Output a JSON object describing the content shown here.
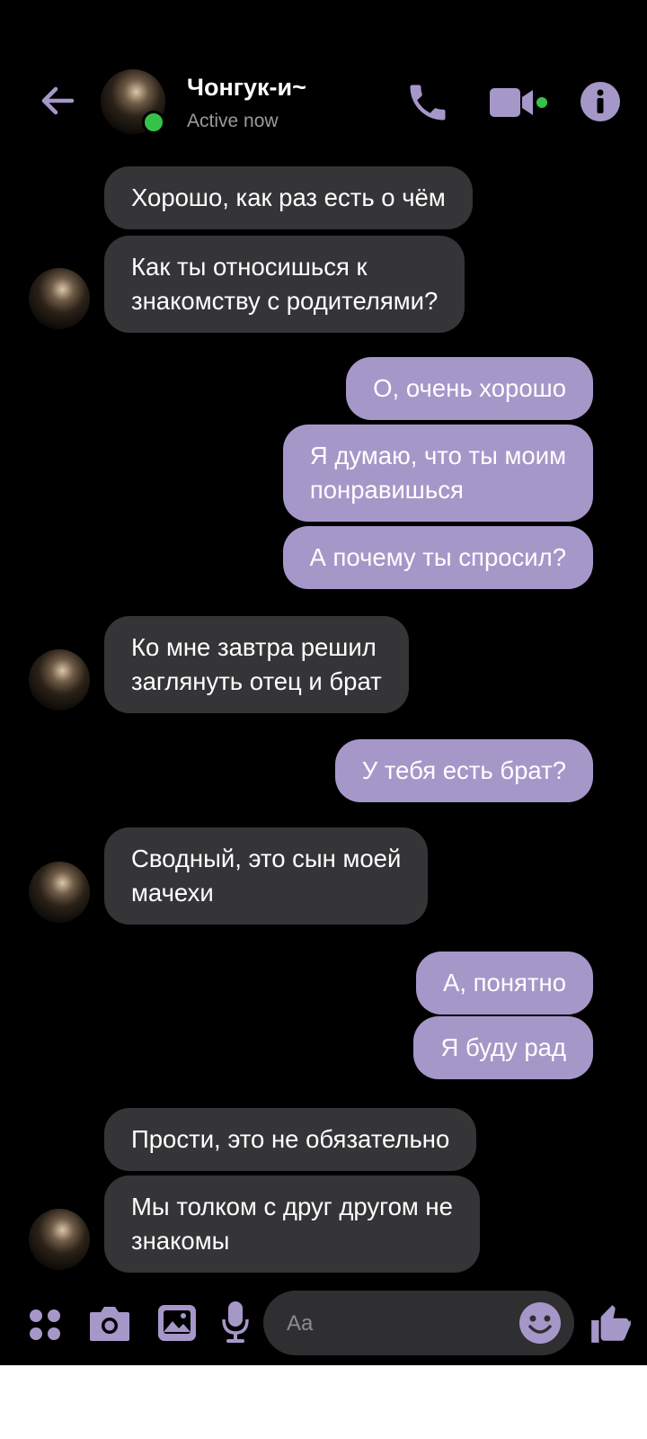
{
  "header": {
    "contact_name": "Чонгук-и~",
    "status": "Active now",
    "icons": [
      "back-arrow-icon",
      "phone-icon",
      "video-camera-icon",
      "info-icon"
    ]
  },
  "messages": [
    {
      "direction": "in",
      "text": "Хорошо, как раз есть о чём"
    },
    {
      "direction": "in",
      "text": "Как ты относишься к\nзнакомству с родителями?"
    },
    {
      "direction": "out",
      "text": "О, очень хорошо"
    },
    {
      "direction": "out",
      "text": "Я думаю, что ты моим\nпонравишься"
    },
    {
      "direction": "out",
      "text": "А почему ты спросил?"
    },
    {
      "direction": "in",
      "text": "Ко мне завтра решил\nзаглянуть отец и брат"
    },
    {
      "direction": "out",
      "text": "У тебя есть брат?"
    },
    {
      "direction": "in",
      "text": "Сводный, это сын моей\nмачехи"
    },
    {
      "direction": "out",
      "text": "А, понятно"
    },
    {
      "direction": "out",
      "text": "Я буду рад"
    },
    {
      "direction": "in",
      "text": "Прости, это не обязательно"
    },
    {
      "direction": "in",
      "text": "Мы толком с друг другом не\nзнакомы"
    }
  ],
  "composer": {
    "placeholder": "Aa",
    "icons": [
      "apps-icon",
      "camera-icon",
      "gallery-icon",
      "microphone-icon",
      "emoji-icon",
      "thumbs-up-icon"
    ]
  },
  "colors": {
    "accent": "#a697c9",
    "incoming_bubble": "#353437",
    "background": "#000000",
    "online": "#35c24a"
  }
}
